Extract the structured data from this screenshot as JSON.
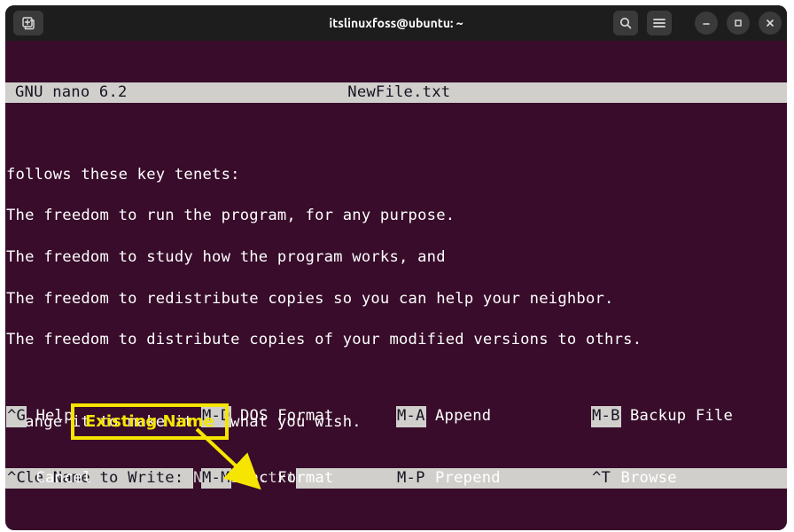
{
  "window": {
    "title": "itslinuxfoss@ubuntu: ~"
  },
  "nano": {
    "app": "GNU nano 6.2",
    "filename": "NewFile.txt"
  },
  "editor_lines": [
    "follows these key tenets:",
    "",
    "The freedom to run the program, for any purpose.",
    "",
    "The freedom to study how the program works, and",
    "",
    "The freedom to redistribute copies so you can help your neighbor.",
    "",
    "The freedom to distribute copies of your modified versions to othrs.",
    "",
    "",
    "",
    "change it to make it do what you wish."
  ],
  "prompt": {
    "label": "File Name to Write: ",
    "value": "NewFile.txt"
  },
  "shortcuts_row1": [
    {
      "key": "^G",
      "desc": "Help"
    },
    {
      "key": "M-D",
      "desc": "DOS Format"
    },
    {
      "key": "M-A",
      "desc": "Append"
    },
    {
      "key": "M-B",
      "desc": "Backup File"
    }
  ],
  "shortcuts_row2": [
    {
      "key": "^C",
      "desc": "Cancel"
    },
    {
      "key": "M-M",
      "desc": "Mac Format"
    },
    {
      "key": "M-P",
      "desc": "Prepend"
    },
    {
      "key": "^T",
      "desc": "Browse"
    }
  ],
  "annotation": {
    "label": "Existing Name"
  }
}
